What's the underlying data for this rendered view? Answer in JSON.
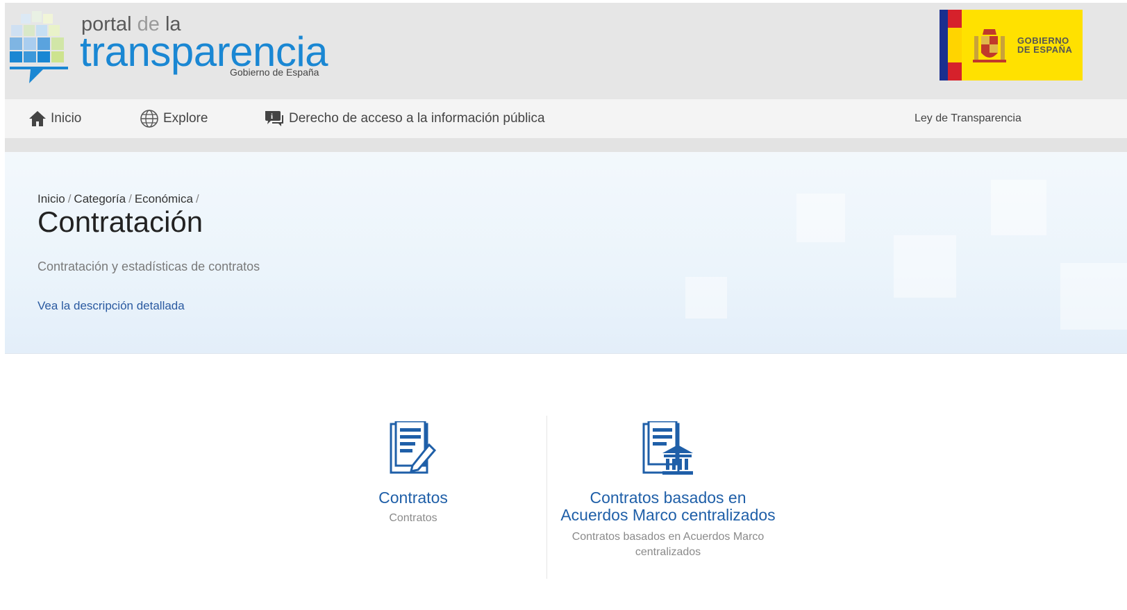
{
  "header": {
    "portal_word": "portal",
    "de_word": "de",
    "la_word": "la",
    "brand": "transparencia",
    "brand_sub": "Gobierno de España",
    "gov_line1": "GOBIERNO",
    "gov_line2": "DE ESPAÑA"
  },
  "nav": {
    "items": [
      {
        "label": "Inicio",
        "icon": "home-icon"
      },
      {
        "label": "Explore",
        "icon": "globe-icon"
      },
      {
        "label": "Derecho de acceso a la información pública",
        "icon": "speech-bubble-icon"
      }
    ],
    "right_link": "Ley de Transparencia"
  },
  "hero": {
    "breadcrumb": [
      "Inicio",
      "Categoría",
      "Económica"
    ],
    "title": "Contratación",
    "description": "Contratación y estadísticas de contratos",
    "detail_link": "Vea la descripción detallada"
  },
  "cards": [
    {
      "title": "Contratos",
      "subtitle": "Contratos",
      "icon": "document-edit-icon"
    },
    {
      "title": "Contratos basados en Acuerdos Marco centralizados",
      "subtitle": "Contratos basados en Acuerdos Marco centralizados",
      "icon": "document-institution-icon"
    }
  ],
  "colors": {
    "brand_blue": "#1a87d3",
    "link_blue": "#2a5aa0",
    "header_bg": "#e6e6e6",
    "gov_yellow": "#ffe100"
  }
}
